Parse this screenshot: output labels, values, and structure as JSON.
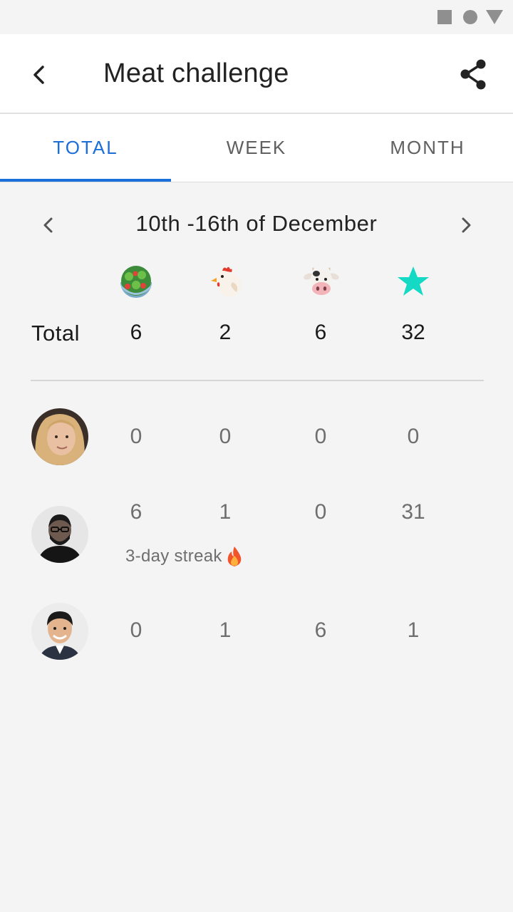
{
  "status_bar": {
    "icons": [
      "square-icon",
      "circle-icon",
      "triangle-icon"
    ]
  },
  "header": {
    "title": "Meat challenge",
    "back_icon": "back-arrow-icon",
    "share_icon": "share-icon"
  },
  "tabs": [
    {
      "label": "TOTAL",
      "active": true
    },
    {
      "label": "WEEK",
      "active": false
    },
    {
      "label": "MONTH",
      "active": false
    }
  ],
  "date_range": {
    "label": "10th -16th of December",
    "prev_icon": "chevron-left-icon",
    "next_icon": "chevron-right-icon"
  },
  "categories": [
    "salad-icon",
    "chicken-icon",
    "cow-icon",
    "star-icon"
  ],
  "colors": {
    "accent": "#1a6fd8",
    "star": "#14d9c4"
  },
  "totals": {
    "label": "Total",
    "values": [
      "6",
      "2",
      "6",
      "32"
    ]
  },
  "participants": [
    {
      "avatar": "avatar-woman-blonde",
      "values": [
        "0",
        "0",
        "0",
        "0"
      ],
      "note": ""
    },
    {
      "avatar": "avatar-man-glasses",
      "values": [
        "6",
        "1",
        "0",
        "31"
      ],
      "note": "3-day streak"
    },
    {
      "avatar": "avatar-man-smiling",
      "values": [
        "0",
        "1",
        "6",
        "1"
      ],
      "note": ""
    }
  ]
}
